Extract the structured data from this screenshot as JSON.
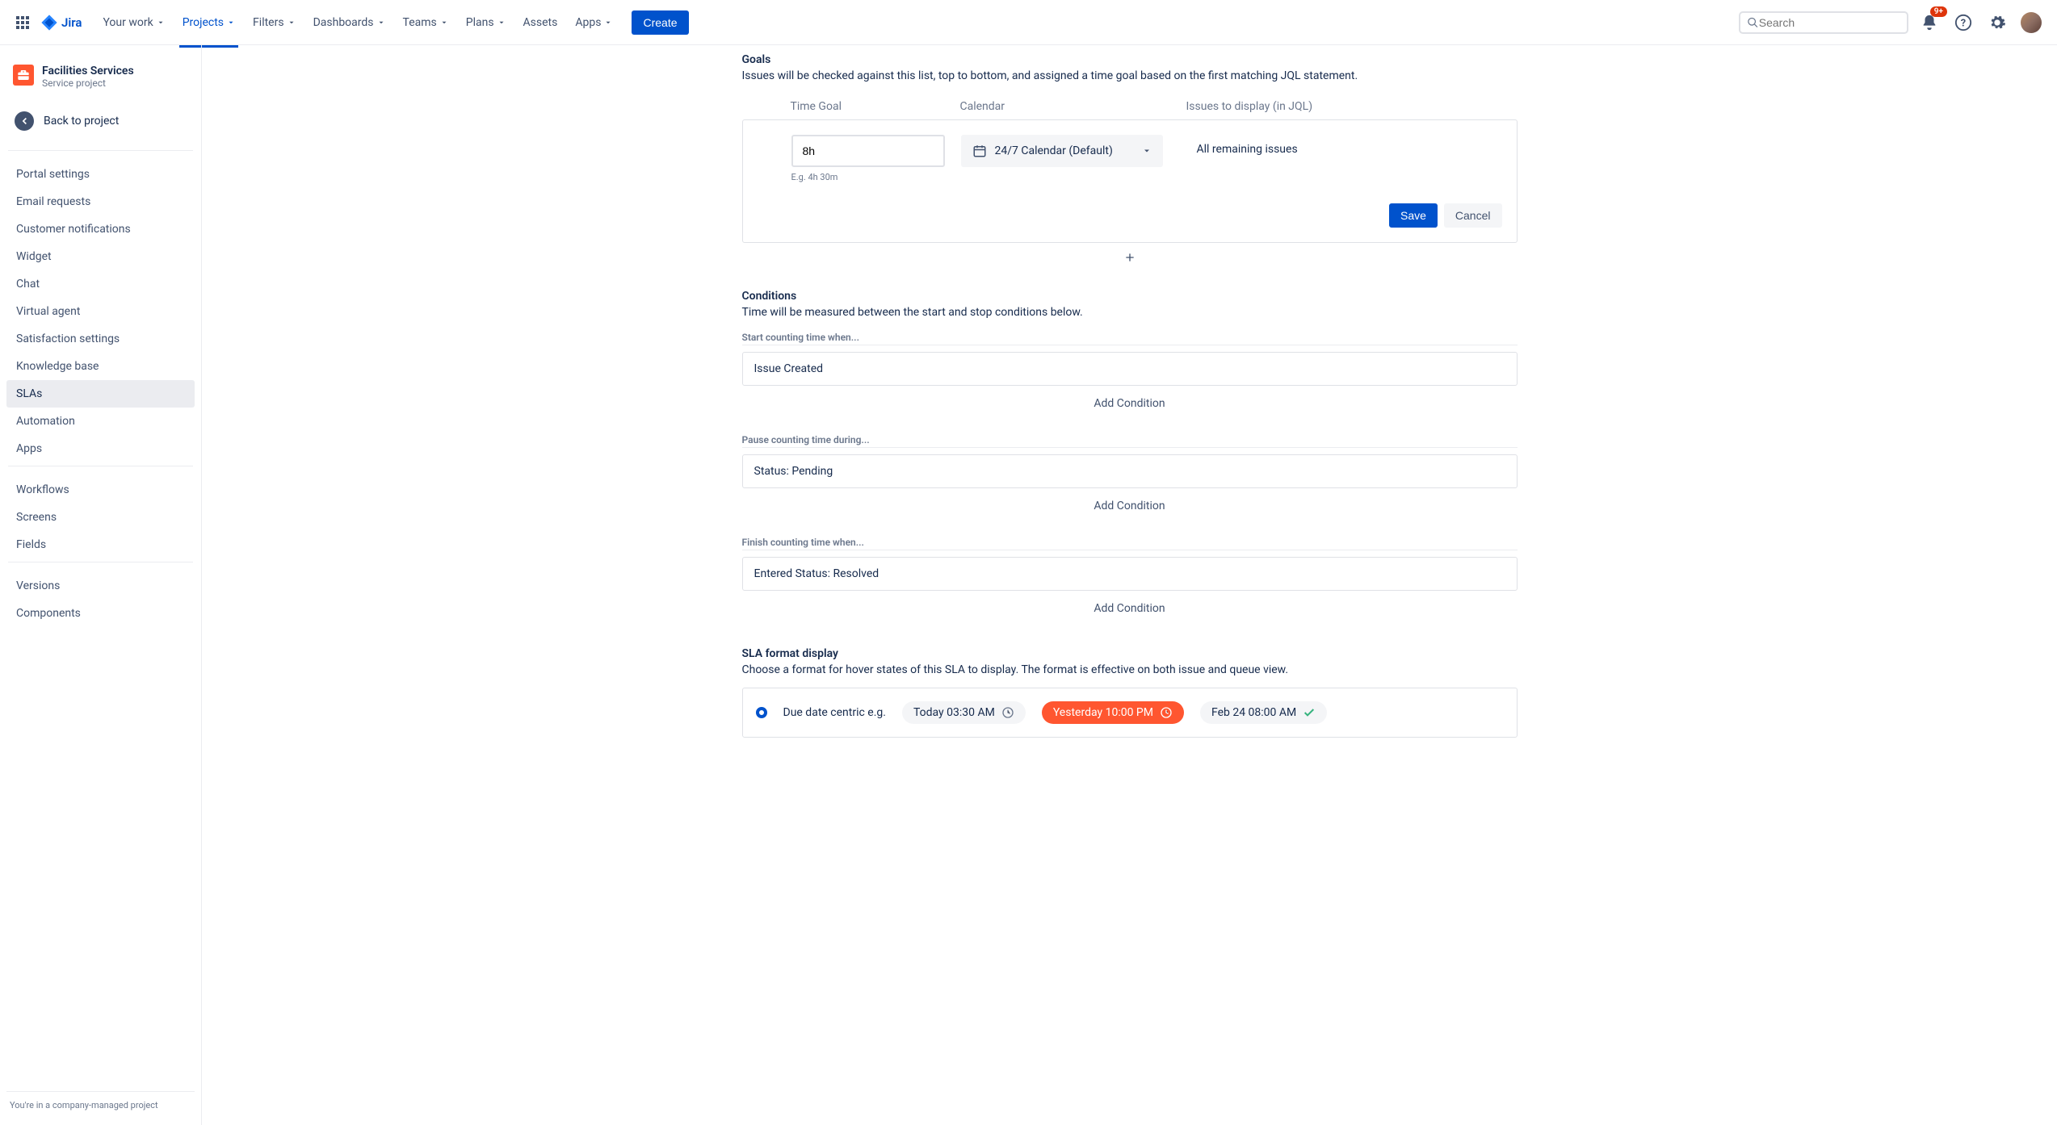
{
  "top_nav": {
    "brand": "Jira",
    "items": [
      {
        "label": "Your work"
      },
      {
        "label": "Projects",
        "active": true
      },
      {
        "label": "Filters"
      },
      {
        "label": "Dashboards"
      },
      {
        "label": "Teams"
      },
      {
        "label": "Plans"
      },
      {
        "label": "Assets",
        "no_chevron": true
      },
      {
        "label": "Apps"
      }
    ],
    "create": "Create",
    "search_placeholder": "Search",
    "notif_count": "9+"
  },
  "sidebar": {
    "project_name": "Facilities Services",
    "project_type": "Service project",
    "back_label": "Back to project",
    "group1": [
      "Portal settings",
      "Email requests",
      "Customer notifications",
      "Widget",
      "Chat",
      "Virtual agent",
      "Satisfaction settings",
      "Knowledge base",
      "SLAs",
      "Automation",
      "Apps"
    ],
    "group2": [
      "Workflows",
      "Screens",
      "Fields"
    ],
    "group3": [
      "Versions",
      "Components"
    ],
    "active": "SLAs",
    "footer": "You're in a company-managed project"
  },
  "goals": {
    "title": "Goals",
    "desc": "Issues will be checked against this list, top to bottom, and assigned a time goal based on the first matching JQL statement.",
    "headers": {
      "time": "Time Goal",
      "cal": "Calendar",
      "jql": "Issues to display (in JQL)"
    },
    "time_value": "8h",
    "time_eg": "E.g. 4h 30m",
    "calendar": "24/7 Calendar (Default)",
    "issues": "All remaining issues",
    "save": "Save",
    "cancel": "Cancel"
  },
  "conditions": {
    "title": "Conditions",
    "desc": "Time will be measured between the start and stop conditions below.",
    "start_label": "Start counting time when...",
    "start_value": "Issue Created",
    "pause_label": "Pause counting time during...",
    "pause_value": "Status: Pending",
    "finish_label": "Finish counting time when...",
    "finish_value": "Entered Status: Resolved",
    "add": "Add Condition"
  },
  "sla_format": {
    "title": "SLA format display",
    "desc": "Choose a format for hover states of this SLA to display. The format is effective on both issue and queue view.",
    "opt_label": "Due date centric e.g.",
    "pill1": "Today 03:30 AM",
    "pill2": "Yesterday 10:00 PM",
    "pill3": "Feb 24 08:00 AM"
  }
}
